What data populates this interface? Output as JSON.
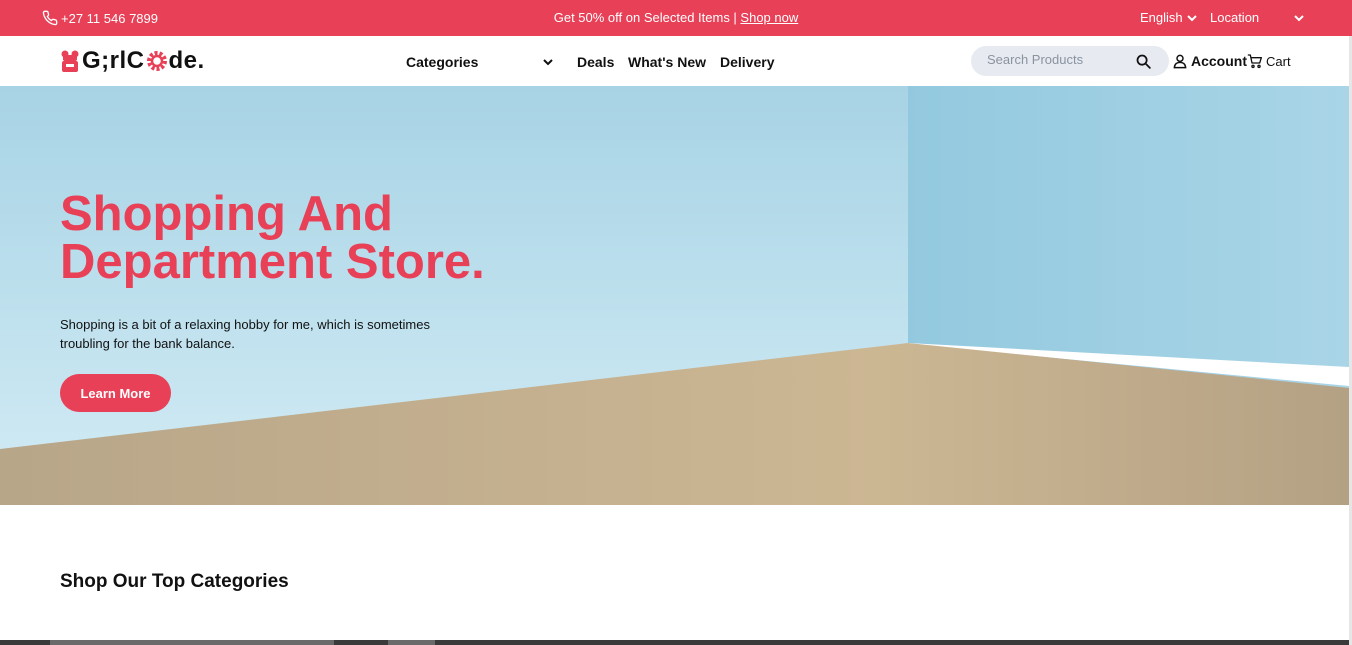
{
  "topbar": {
    "phone": "+27 11 546 7899",
    "promo_text": "Get 50% off on Selected Items | ",
    "promo_link": "Shop now",
    "language": "English",
    "location": "Location"
  },
  "nav": {
    "logo": {
      "part1": "G",
      "part2": ";rlC",
      "part3": "de."
    },
    "categories": "Categories",
    "links": [
      "Deals",
      "What's New",
      "Delivery"
    ],
    "search_placeholder": "Search Products",
    "account": "Account",
    "cart": "Cart"
  },
  "hero": {
    "title_line1": "Shopping And",
    "title_line2": "Department Store.",
    "subtitle": "Shopping is a bit of a relaxing hobby for me, which is sometimes troubling for the bank balance.",
    "button": "Learn More"
  },
  "section": {
    "title": "Shop Our Top Categories"
  },
  "colors": {
    "accent": "#e84057",
    "sky": "#a9d4e6",
    "floor": "#c5b18f"
  },
  "icons": [
    "phone-icon",
    "chevron-down-icon",
    "search-icon",
    "user-icon",
    "cart-icon"
  ]
}
